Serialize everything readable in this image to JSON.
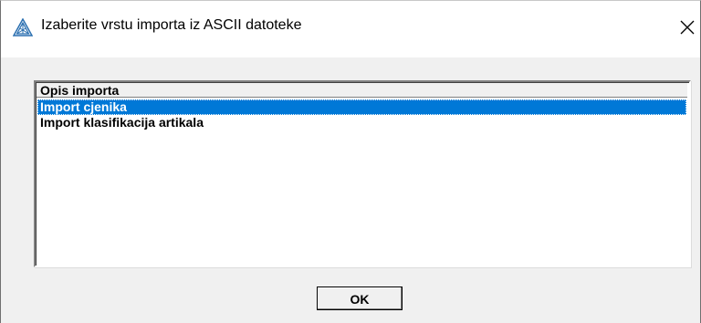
{
  "window": {
    "title": "Izaberite vrstu importa iz ASCII datoteke",
    "app_icon": "triangle-logo-icon",
    "close_icon": "close-icon",
    "close_symbol": "✕"
  },
  "list": {
    "header": "Opis importa",
    "items": [
      {
        "label": "Import cjenika",
        "selected": true
      },
      {
        "label": "Import klasifikacija artikala",
        "selected": false
      }
    ]
  },
  "buttons": {
    "ok_label": "OK"
  },
  "colors": {
    "selection": "#0078d7",
    "background": "#f0f0f0",
    "titlebar": "#ffffff"
  }
}
